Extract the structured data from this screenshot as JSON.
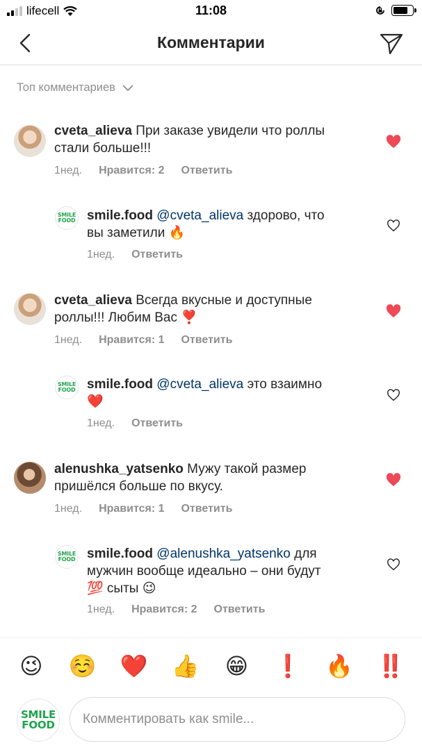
{
  "status_bar": {
    "carrier": "lifecell",
    "time": "11:08"
  },
  "header": {
    "title": "Комментарии"
  },
  "sort": {
    "label": "Топ комментариев"
  },
  "comments": [
    {
      "user": "cveta_alieva",
      "mention": "",
      "text": "При заказе увидели что роллы",
      "text2": "стали больше!!!",
      "time": "1нед.",
      "likes": "Нравится: 2",
      "reply": "Ответить",
      "liked": true
    },
    {
      "user": "smile.food",
      "mention": "@cveta_alieva",
      "text": "здорово, что",
      "text2": "вы заметили 🔥",
      "time": "1нед.",
      "likes": "",
      "reply": "Ответить",
      "liked": false
    },
    {
      "user": "cveta_alieva",
      "mention": "",
      "text": "Всегда вкусные и доступные",
      "text2": "роллы!!! Любим Вас ❣️",
      "time": "1нед.",
      "likes": "Нравится: 1",
      "reply": "Ответить",
      "liked": true
    },
    {
      "user": "smile.food",
      "mention": "@cveta_alieva",
      "text": "это взаимно",
      "text2": "❤️",
      "time": "1нед.",
      "likes": "",
      "reply": "Ответить",
      "liked": false
    },
    {
      "user": "alenushka_yatsenko",
      "mention": "",
      "text": "Мужу такой размер",
      "text2": "пришёлся больше по вкусу.",
      "time": "1нед.",
      "likes": "Нравится: 1",
      "reply": "Ответить",
      "liked": true
    },
    {
      "user": "smile.food",
      "mention": "@alenushka_yatsenko",
      "text": "для",
      "text2": "мужчин вообще идеально – они будут",
      "text3": "💯 сыты 😉",
      "time": "1нед.",
      "likes": "Нравится: 2",
      "reply": "Ответить",
      "liked": false
    }
  ],
  "reactions": [
    "😉",
    "☺️",
    "❤️",
    "👍",
    "😁",
    "❗",
    "🔥",
    "‼️"
  ],
  "composer": {
    "placeholder": "Комментировать как smile...",
    "brand_line1": "SMILE",
    "brand_line2": "FOOD"
  },
  "colors": {
    "like_red": "#ed4956",
    "mention_blue": "#003569",
    "brand_green": "#1ea44b"
  }
}
